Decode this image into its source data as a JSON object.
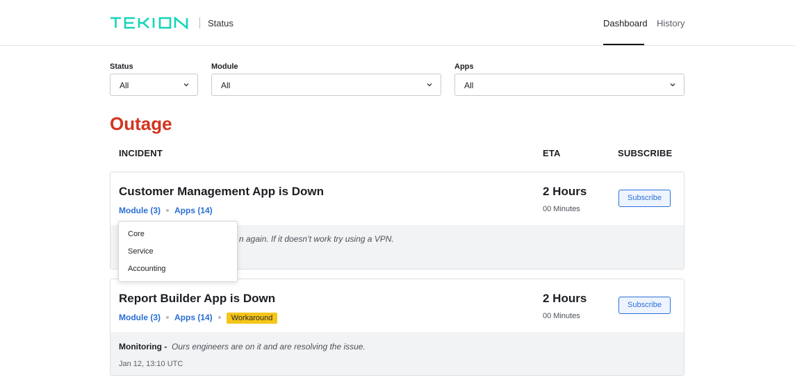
{
  "header": {
    "brand": "TEKION",
    "subtitle": "Status",
    "nav": [
      {
        "label": "Dashboard",
        "active": true
      },
      {
        "label": "History",
        "active": false
      }
    ],
    "brand_color": "#12d6b8"
  },
  "filters": [
    {
      "label": "Status",
      "value": "All"
    },
    {
      "label": "Module",
      "value": "All"
    },
    {
      "label": "Apps",
      "value": "All"
    }
  ],
  "section": {
    "title": "Outage",
    "title_color": "#d3341e",
    "columns": [
      "INCIDENT",
      "ETA",
      "SUBSCRIBE"
    ]
  },
  "incidents": [
    {
      "title": "Customer Management App is Down",
      "module_link": "Module (3)",
      "apps_link": "Apps (14)",
      "eta_hours": "2 Hours",
      "eta_minutes": "00 Minutes",
      "subscribe_label": "Subscribe",
      "update_text_visible": "n again. If it doesn’t work try using a VPN."
    },
    {
      "title": "Report Builder App is Down",
      "module_link": "Module (3)",
      "apps_link": "Apps (14)",
      "badge": "Workaround",
      "eta_hours": "2 Hours",
      "eta_minutes": "00 Minutes",
      "subscribe_label": "Subscribe",
      "update_status": "Monitoring -",
      "update_text": "Ours engineers are on it and are resolving the issue.",
      "update_time": "Jan 12, 13:10 UTC"
    }
  ],
  "module_popover": {
    "items": [
      "Core",
      "Service",
      "Accounting"
    ]
  },
  "icons": {
    "select_chevron": "chevron-down-icon"
  }
}
